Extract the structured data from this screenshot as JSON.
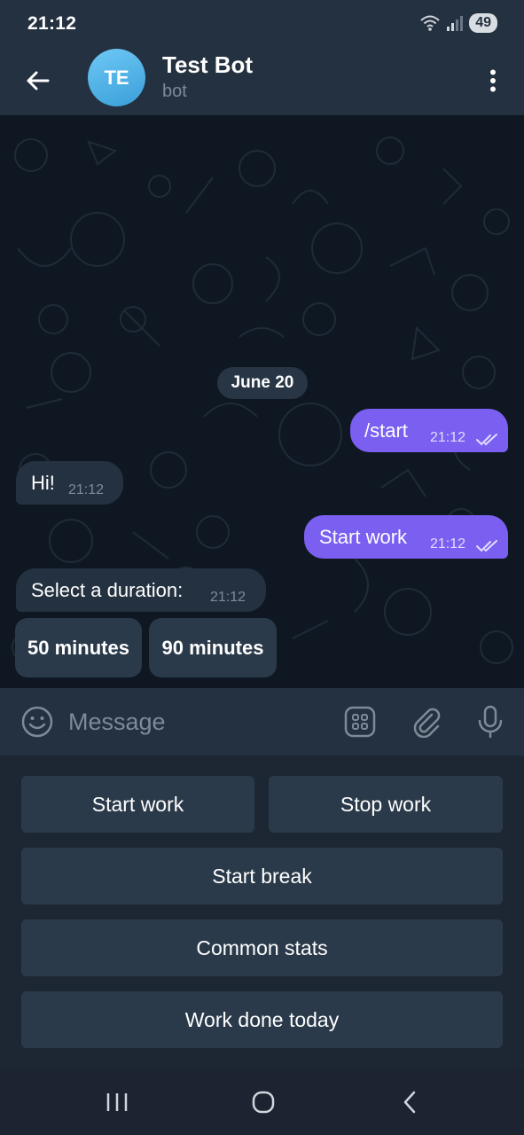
{
  "status_bar": {
    "time": "21:12",
    "battery": "49"
  },
  "header": {
    "avatar_initials": "TE",
    "title": "Test Bot",
    "subtitle": "bot"
  },
  "chat": {
    "date_label": "June 20",
    "messages": [
      {
        "direction": "outgoing",
        "text": "/start",
        "time": "21:12"
      },
      {
        "direction": "incoming",
        "text": "Hi!",
        "time": "21:12"
      },
      {
        "direction": "outgoing",
        "text": "Start work",
        "time": "21:12"
      },
      {
        "direction": "incoming",
        "text": "Select a duration:",
        "time": "21:12"
      }
    ],
    "inline_buttons": [
      "50 minutes",
      "90 minutes"
    ]
  },
  "input": {
    "placeholder": "Message"
  },
  "keyboard": {
    "rows": [
      [
        "Start work",
        "Stop work"
      ],
      [
        "Start break"
      ],
      [
        "Common stats"
      ],
      [
        "Work done today"
      ]
    ]
  },
  "colors": {
    "accent_bubble": "#7a5ff0",
    "header_bg": "#243140",
    "chat_bg": "#0f1822",
    "avatar": "#4fb2e8"
  }
}
